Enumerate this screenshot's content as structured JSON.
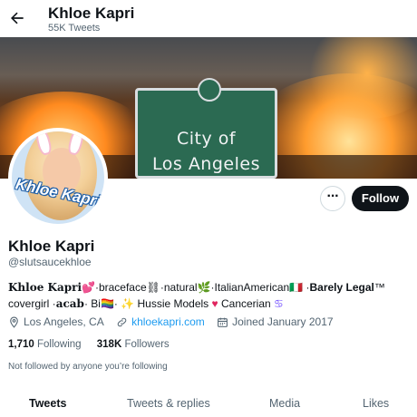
{
  "header": {
    "title": "Khloe Kapri",
    "tweet_count": "55K Tweets"
  },
  "banner": {
    "sign_line1": "City of",
    "sign_line2": "Los Angeles"
  },
  "avatar": {
    "logo_text": "Khloe Kapri"
  },
  "profile": {
    "name": "Khloe Kapri",
    "handle": "@slutsaucekhloe",
    "follow_label": "Follow",
    "more_label": "···"
  },
  "bio": {
    "part1": "Khloe Kapri",
    "part2": "💕·braceface⛓·natural🌿·ItalianAmerican🇮🇹 ·",
    "part3": "Barely Legal",
    "part4": "™",
    "line2a": "covergirl ·",
    "line2b": "acab",
    "line2c": "· Bi🏳️‍🌈· ✨ Hussie Models ",
    "heart": "♥",
    "line2d": " Cancerian",
    "cancer": "♋"
  },
  "meta": {
    "location": "Los Angeles, CA",
    "website": "khloekapri.com",
    "joined": "Joined January 2017"
  },
  "stats": {
    "following_count": "1,710",
    "following_label": "Following",
    "followers_count": "318K",
    "followers_label": "Followers"
  },
  "mutual_text": "Not followed by anyone you’re following",
  "tabs": [
    {
      "label": "Tweets"
    },
    {
      "label": "Tweets & replies"
    },
    {
      "label": "Media"
    },
    {
      "label": "Likes"
    }
  ],
  "colors": {
    "accent": "#1d9bf0",
    "text": "#0f1419",
    "muted": "#536471"
  }
}
